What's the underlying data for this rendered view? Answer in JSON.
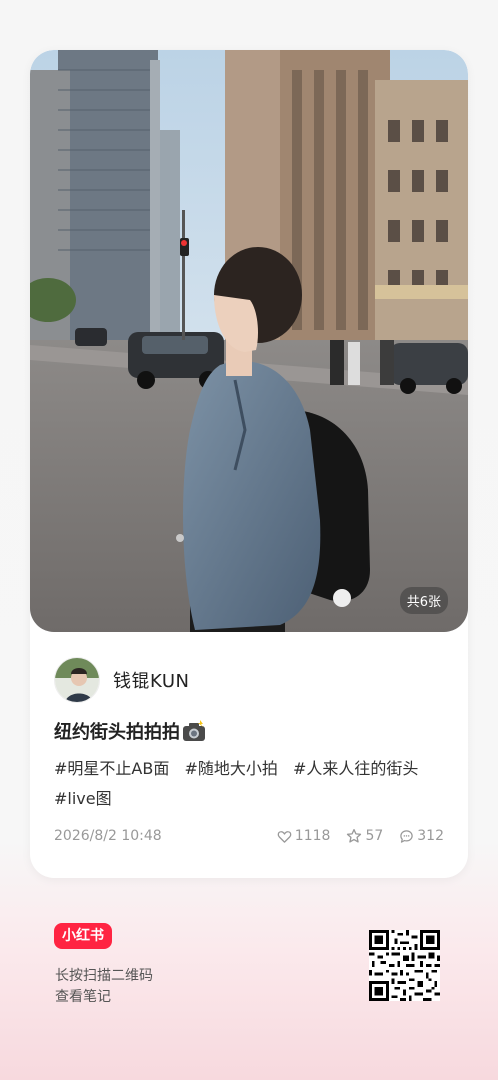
{
  "post": {
    "image_count": "共6张",
    "author_name": "钱锟KUN",
    "title": "纽约街头拍拍拍",
    "title_icon": "camera-flash-icon",
    "tags": [
      "#明星不止AB面",
      "#随地大小拍",
      "#人来人往的街头",
      "#live图"
    ],
    "date": "2026/8/2 10:48",
    "likes": "1118",
    "favorites": "57",
    "comments": "312"
  },
  "footer": {
    "brand": "小红书",
    "hint_line1": "长按扫描二维码",
    "hint_line2": "查看笔记"
  },
  "colors": {
    "brand": "#ff2442",
    "meta_text": "#999999",
    "footer_pink": "#f7d9de"
  }
}
